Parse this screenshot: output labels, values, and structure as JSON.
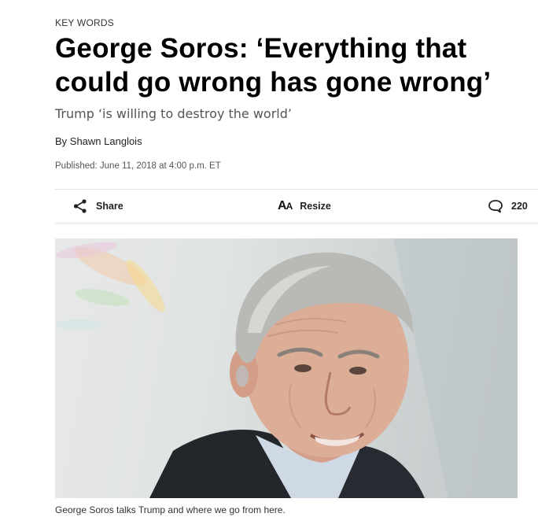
{
  "article": {
    "kicker": "KEY WORDS",
    "headline": "George Soros: ‘Everything that could go wrong has gone wrong’",
    "dek": "Trump ‘is willing to destroy the world’",
    "byline": "By Shawn Langlois",
    "published": "Published: June 11, 2018 at 4:00 p.m. ET"
  },
  "toolbar": {
    "share_label": "Share",
    "resize_label": "Resize",
    "comment_count": "220"
  },
  "photo": {
    "caption": "George Soros talks Trump and where we go from here."
  },
  "colors": {
    "text": "#000000",
    "muted": "#555555",
    "rule": "#e2e2e2"
  }
}
